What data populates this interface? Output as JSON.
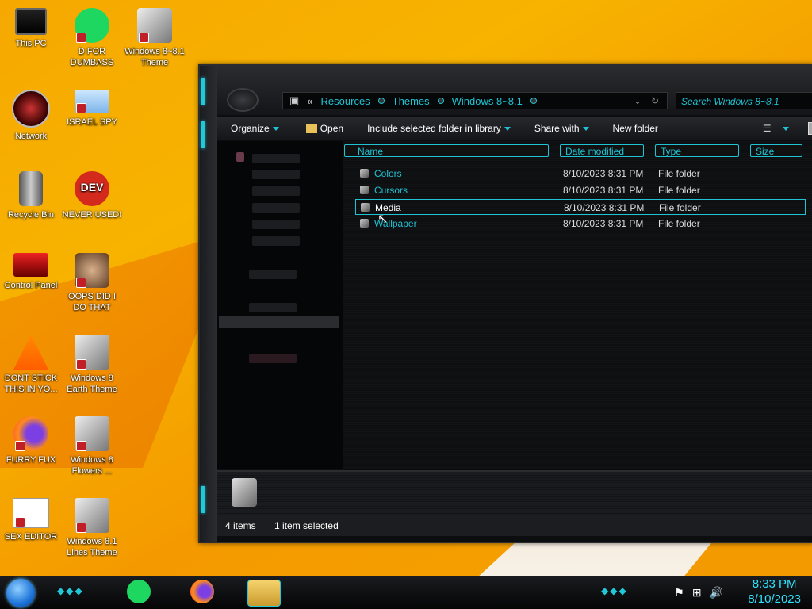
{
  "desktop": {
    "icons": [
      {
        "label": "This PC"
      },
      {
        "label": "D FOR DUMBASS"
      },
      {
        "label": "Windows 8~8.1 Theme"
      },
      {
        "label": "Network"
      },
      {
        "label": "ISRAEL SPY"
      },
      {
        "label": "Recycle Bin"
      },
      {
        "label": "NEVER USED!"
      },
      {
        "label": "Control Panel"
      },
      {
        "label": "OOPS DID I DO THAT"
      },
      {
        "label": "DONT STICK THIS IN YO..."
      },
      {
        "label": "Windows 8 Earth Theme"
      },
      {
        "label": "FURRY FUX"
      },
      {
        "label": "Windows 8 Flowers ..."
      },
      {
        "label": "SEX EDITOR"
      },
      {
        "label": "Windows 8.1 Lines Theme"
      }
    ]
  },
  "explorer": {
    "breadcrumb": {
      "prefix": "«",
      "items": [
        "Resources",
        "Themes",
        "Windows 8~8.1"
      ]
    },
    "search_placeholder": "Search Windows 8~8.1",
    "toolbar": {
      "organize": "Organize",
      "open": "Open",
      "include": "Include selected folder in library",
      "share": "Share with",
      "new_folder": "New folder"
    },
    "columns": {
      "name": "Name",
      "date": "Date modified",
      "type": "Type",
      "size": "Size"
    },
    "files": [
      {
        "name": "Colors",
        "date": "8/10/2023 8:31 PM",
        "type": "File folder"
      },
      {
        "name": "Cursors",
        "date": "8/10/2023 8:31 PM",
        "type": "File folder"
      },
      {
        "name": "Media",
        "date": "8/10/2023 8:31 PM",
        "type": "File folder"
      },
      {
        "name": "Wallpaper",
        "date": "8/10/2023 8:31 PM",
        "type": "File folder"
      }
    ],
    "status": {
      "items": "4 items",
      "selected": "1 item selected"
    }
  },
  "taskbar": {
    "time": "8:33 PM",
    "date": "8/10/2023"
  },
  "colors": {
    "accent": "#1fc3d3",
    "wallpaper": "#f6a800"
  }
}
